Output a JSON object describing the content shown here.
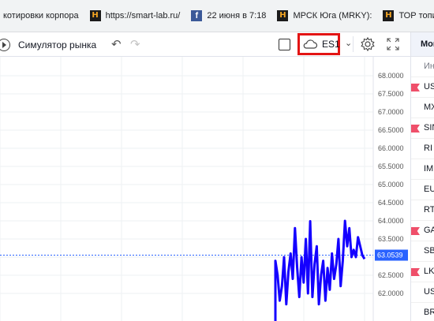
{
  "bookmarks": [
    {
      "label": "котировки корпора",
      "icon": "none"
    },
    {
      "label": "https://smart-lab.ru/",
      "icon": "smartlab-icon"
    },
    {
      "label": "22 июня в 7:18",
      "icon": "facebook-icon"
    },
    {
      "label": "МРСК Юга (MRKY):",
      "icon": "smartlab-icon"
    },
    {
      "label": "ТОР топиков Z",
      "icon": "smartlab-icon"
    }
  ],
  "favicon_text": {
    "smartlab": "H",
    "facebook": "f"
  },
  "toolbar": {
    "simulator_label": "Симулятор рынка",
    "undo_glyph": "↶",
    "redo_glyph": "↷",
    "symbol": "ES1",
    "caret": "⌄"
  },
  "panel": {
    "title": "Мой",
    "header_label": "Инс",
    "items": [
      {
        "label": "US",
        "flag": true
      },
      {
        "label": "MX",
        "flag": false
      },
      {
        "label": "SIN",
        "flag": true
      },
      {
        "label": "RI",
        "flag": false
      },
      {
        "label": "IM",
        "flag": false
      },
      {
        "label": "EU",
        "flag": false
      },
      {
        "label": "RT",
        "flag": false
      },
      {
        "label": "GA",
        "flag": true
      },
      {
        "label": "SB",
        "flag": false
      },
      {
        "label": "LK",
        "flag": true
      },
      {
        "label": "US",
        "flag": false
      },
      {
        "label": "BR",
        "flag": false
      }
    ]
  },
  "chart_data": {
    "type": "line",
    "y_axis_labels": [
      "68.0000",
      "67.5000",
      "67.0000",
      "66.5000",
      "66.0000",
      "65.5000",
      "65.0000",
      "64.5000",
      "64.0000",
      "63.5000",
      "63.0000",
      "62.5000",
      "62.0000"
    ],
    "ylim": [
      61.75,
      68.25
    ],
    "last_price": "63.0539",
    "last_price_value": 63.0539,
    "colors": {
      "line": "#1400ff",
      "price_line": "#2962ff",
      "grid": "#eef0f3",
      "highlight": "#e31414"
    },
    "series": [
      {
        "values": [
          62.9,
          62.5,
          61.8,
          62.2,
          63.0,
          61.7,
          62.6,
          63.1,
          62.4,
          63.8,
          62.7,
          61.9,
          63.0,
          62.3,
          63.5,
          62.0,
          63.99,
          61.9,
          62.8,
          63.3,
          61.7,
          62.5,
          62.9,
          61.8,
          62.7,
          62.1,
          63.1,
          62.4,
          62.8,
          63.5,
          62.2,
          62.9,
          64.0,
          63.3,
          63.8,
          63.0,
          63.2,
          63.0,
          63.55,
          63.3,
          63.05,
          62.95
        ]
      }
    ]
  }
}
